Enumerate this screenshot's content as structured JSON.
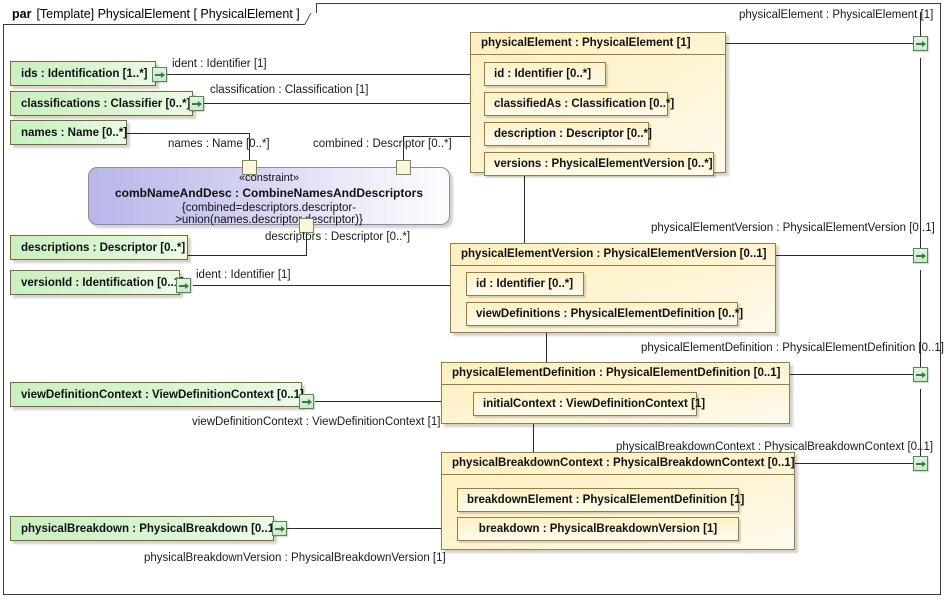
{
  "frame": {
    "keyword": "par",
    "title": "[Template] PhysicalElement [ PhysicalElement ]"
  },
  "green_nodes": [
    {
      "id": "ids",
      "label": "ids : Identification [1..*]"
    },
    {
      "id": "classifications",
      "label": "classifications : Classifier [0..*]"
    },
    {
      "id": "names",
      "label": "names : Name [0..*]"
    },
    {
      "id": "descriptions",
      "label": "descriptions : Descriptor [0..*]"
    },
    {
      "id": "versionId",
      "label": "versionId : Identification [0..1]"
    },
    {
      "id": "viewDefinitionContext",
      "label": "viewDefinitionContext : ViewDefinitionContext [0..1]"
    },
    {
      "id": "physicalBreakdown",
      "label": "physicalBreakdown : PhysicalBreakdown [0..1]"
    }
  ],
  "constraint": {
    "stereotype": "«constraint»",
    "name": "combNameAndDesc : CombineNamesAndDescriptors",
    "expression": "{combined=descriptors.descriptor->union(names.descriptor.descriptor)}"
  },
  "blocks": [
    {
      "id": "physicalElement",
      "header": "physicalElement : PhysicalElement [1]",
      "props": [
        "id : Identifier [0..*]",
        "classifiedAs : Classification [0..*]",
        "description : Descriptor [0..*]",
        "versions : PhysicalElementVersion [0..*]"
      ]
    },
    {
      "id": "physicalElementVersion",
      "header": "physicalElementVersion : PhysicalElementVersion [0..1]",
      "props": [
        "id : Identifier [0..*]",
        "viewDefinitions : PhysicalElementDefinition [0..*]"
      ]
    },
    {
      "id": "physicalElementDefinition",
      "header": "physicalElementDefinition : PhysicalElementDefinition [0..1]",
      "props": [
        "initialContext : ViewDefinitionContext [1]"
      ]
    },
    {
      "id": "physicalBreakdownContext",
      "header": "physicalBreakdownContext : PhysicalBreakdownContext [0..1]",
      "props": [
        "breakdownElement : PhysicalElementDefinition [1]",
        "breakdown : PhysicalBreakdownVersion [1]"
      ]
    }
  ],
  "edge_labels": {
    "ident_top": "ident : Identifier [1]",
    "classification": "classification : Classification [1]",
    "names": "names : Name [0..*]",
    "combined": "combined : Descriptor [0..*]",
    "descriptors": "descriptors : Descriptor [0..*]",
    "ident_version": "ident : Identifier [1]",
    "viewDefinitionContext": "viewDefinitionContext : ViewDefinitionContext [1]",
    "physicalBreakdownVersion": "physicalBreakdownVersion : PhysicalBreakdownVersion [1]",
    "out_physicalElement": "physicalElement : PhysicalElement [1]",
    "out_physicalElementVersion": "physicalElementVersion : PhysicalElementVersion [0..1]",
    "out_physicalElementDefinition": "physicalElementDefinition : PhysicalElementDefinition [0..1]",
    "out_physicalBreakdownContext": "physicalBreakdownContext : PhysicalBreakdownContext [0..1]"
  },
  "colors": {
    "green_fill": "#cdf2c6",
    "yellow_fill": "#fdf2c8",
    "constraint_fill": "#bcb9ec",
    "border": "#9a7d3c",
    "port_border": "#4f8b58",
    "line": "#2a2a2a"
  }
}
